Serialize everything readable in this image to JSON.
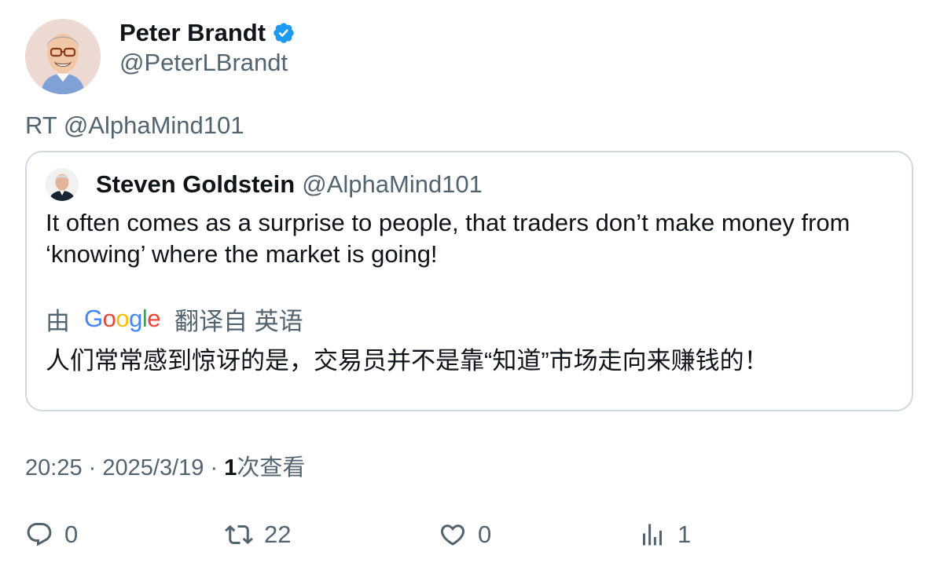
{
  "author": {
    "name": "Peter Brandt",
    "handle": "@PeterLBrandt",
    "verified_color": "#1d9bf0"
  },
  "retweet_line": "RT @AlphaMind101",
  "quoted": {
    "name": "Steven Goldstein",
    "handle": "@AlphaMind101",
    "text": "It often comes as a surprise to people, that traders don’t make money from ‘knowing’ where the market is going!",
    "translation": {
      "by_label": "由",
      "provider": "Google",
      "from_label": "翻译自 英语",
      "text": "人们常常感到惊讶的是，交易员并不是靠“知道”市场走向来赚钱的！"
    }
  },
  "meta": {
    "time": "20:25",
    "separator": "·",
    "date": "2025/3/19",
    "views_count": "1",
    "views_label": "次查看"
  },
  "actions": {
    "replies": "0",
    "retweets": "22",
    "likes": "0",
    "views": "1"
  },
  "icons": {
    "verified": "verified-badge-icon",
    "reply": "reply-icon",
    "retweet": "retweet-icon",
    "like": "heart-icon",
    "views": "analytics-icon"
  }
}
